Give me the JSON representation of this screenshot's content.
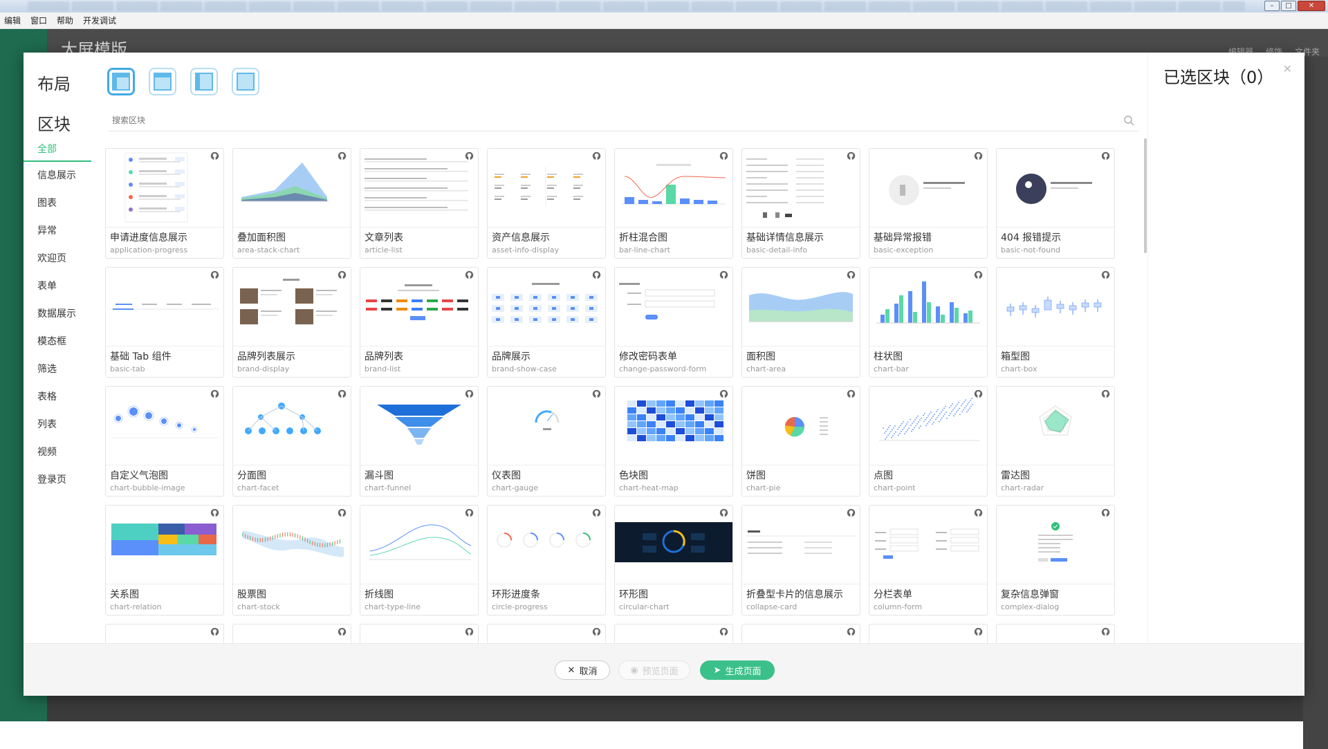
{
  "window": {
    "menus": [
      "编辑",
      "窗口",
      "帮助",
      "开发调试"
    ]
  },
  "app": {
    "title": "大屏模版",
    "header_right": [
      "编辑器",
      "修饰",
      "文件夹"
    ]
  },
  "modal": {
    "layout_heading": "布局",
    "block_heading": "区块",
    "layouts": [
      {
        "name": "layout-header-sidebar",
        "selected": true
      },
      {
        "name": "layout-header",
        "selected": false
      },
      {
        "name": "layout-sidebar",
        "selected": false
      },
      {
        "name": "layout-blank",
        "selected": false
      }
    ],
    "categories": [
      "全部",
      "信息展示",
      "图表",
      "异常",
      "欢迎页",
      "表单",
      "数据展示",
      "模态框",
      "筛选",
      "表格",
      "列表",
      "视频",
      "登录页"
    ],
    "active_category": "全部",
    "search_placeholder": "搜索区块",
    "selected_title": "已选区块（0）",
    "close_icon": "close-icon",
    "blocks": [
      {
        "name": "申请进度信息展示",
        "id": "application-progress",
        "thumb": "progress"
      },
      {
        "name": "叠加面积图",
        "id": "area-stack-chart",
        "thumb": "areastack"
      },
      {
        "name": "文章列表",
        "id": "article-list",
        "thumb": "list"
      },
      {
        "name": "资产信息展示",
        "id": "asset-info-display",
        "thumb": "asset"
      },
      {
        "name": "折柱混合图",
        "id": "bar-line-chart",
        "thumb": "barline"
      },
      {
        "name": "基础详情信息展示",
        "id": "basic-detail-info",
        "thumb": "detail"
      },
      {
        "name": "基础异常报错",
        "id": "basic-exception",
        "thumb": "exception"
      },
      {
        "name": "404 报错提示",
        "id": "basic-not-found",
        "thumb": "notfound"
      },
      {
        "name": "基础 Tab 组件",
        "id": "basic-tab",
        "thumb": "tab"
      },
      {
        "name": "品牌列表展示",
        "id": "brand-display",
        "thumb": "brandgrid"
      },
      {
        "name": "品牌列表",
        "id": "brand-list",
        "thumb": "brandlist"
      },
      {
        "name": "品牌展示",
        "id": "brand-show-case",
        "thumb": "showcase"
      },
      {
        "name": "修改密码表单",
        "id": "change-password-form",
        "thumb": "form"
      },
      {
        "name": "面积图",
        "id": "chart-area",
        "thumb": "area"
      },
      {
        "name": "柱状图",
        "id": "chart-bar",
        "thumb": "bar"
      },
      {
        "name": "箱型图",
        "id": "chart-box",
        "thumb": "box"
      },
      {
        "name": "自定义气泡图",
        "id": "chart-bubble-image",
        "thumb": "bubble"
      },
      {
        "name": "分面图",
        "id": "chart-facet",
        "thumb": "facet"
      },
      {
        "name": "漏斗图",
        "id": "chart-funnel",
        "thumb": "funnel"
      },
      {
        "name": "仪表图",
        "id": "chart-gauge",
        "thumb": "gauge"
      },
      {
        "name": "色块图",
        "id": "chart-heat-map",
        "thumb": "heat"
      },
      {
        "name": "饼图",
        "id": "chart-pie",
        "thumb": "pie"
      },
      {
        "name": "点图",
        "id": "chart-point",
        "thumb": "point"
      },
      {
        "name": "雷达图",
        "id": "chart-radar",
        "thumb": "radar"
      },
      {
        "name": "关系图",
        "id": "chart-relation",
        "thumb": "treemap"
      },
      {
        "name": "股票图",
        "id": "chart-stock",
        "thumb": "stock"
      },
      {
        "name": "折线图",
        "id": "chart-type-line",
        "thumb": "line"
      },
      {
        "name": "环形进度条",
        "id": "circle-progress",
        "thumb": "circles"
      },
      {
        "name": "环形图",
        "id": "circular-chart",
        "thumb": "dark"
      },
      {
        "name": "折叠型卡片的信息展示",
        "id": "collapse-card",
        "thumb": "collapse"
      },
      {
        "name": "分栏表单",
        "id": "column-form",
        "thumb": "colform"
      },
      {
        "name": "复杂信息弹窗",
        "id": "complex-dialog",
        "thumb": "dialog"
      },
      {
        "name": "",
        "id": "",
        "thumb": "blank"
      },
      {
        "name": "",
        "id": "",
        "thumb": "blank"
      },
      {
        "name": "",
        "id": "",
        "thumb": "blank"
      },
      {
        "name": "",
        "id": "",
        "thumb": "blank"
      },
      {
        "name": "",
        "id": "",
        "thumb": "blank"
      },
      {
        "name": "",
        "id": "",
        "thumb": "blank"
      },
      {
        "name": "",
        "id": "",
        "thumb": "blank"
      },
      {
        "name": "",
        "id": "",
        "thumb": "blank"
      }
    ],
    "footer": {
      "cancel": "取消",
      "preview": "预览页面",
      "generate": "生成页面"
    }
  },
  "colors": {
    "accent": "#2fc07e",
    "primary_button": "#3cc08a",
    "layout_icon": "#5fb9ea"
  }
}
